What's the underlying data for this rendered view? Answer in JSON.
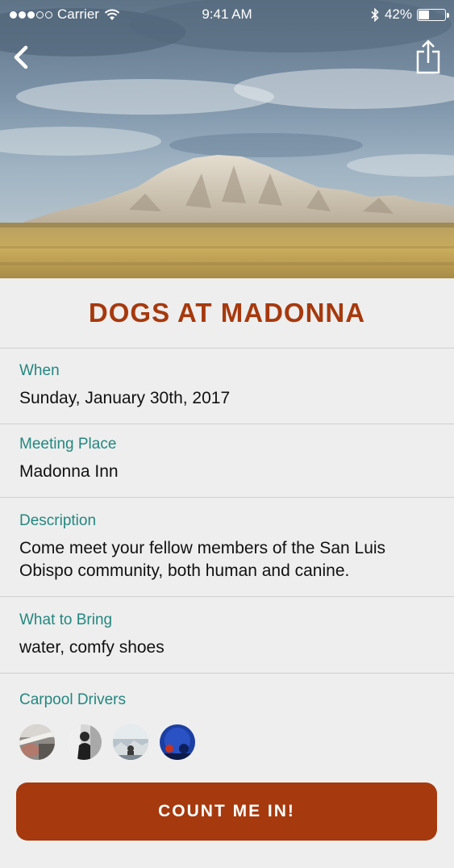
{
  "status_bar": {
    "carrier": "Carrier",
    "time": "9:41 AM",
    "battery": "42%",
    "battery_level": 0.42,
    "signal_bars_filled": 3,
    "signal_bars_total": 5
  },
  "nav": {
    "back_icon": "chevron-left-icon",
    "share_icon": "share-icon"
  },
  "event": {
    "title": "DOGS AT MADONNA"
  },
  "details": {
    "when_label": "When",
    "when_value": "Sunday, January 30th, 2017",
    "place_label": "Meeting Place",
    "place_value": "Madonna Inn",
    "description_label": "Description",
    "description_value": "Come meet your fellow members of the San Luis Obispo community, both human and canine.",
    "bring_label": "What to Bring",
    "bring_value": "water, comfy shoes"
  },
  "carpool": {
    "label": "Carpool Drivers",
    "driver_count": 4
  },
  "cta": {
    "label": "COUNT ME IN!"
  },
  "colors": {
    "accent": "#a6390d",
    "label": "#23877f",
    "background": "#eeeeee"
  }
}
